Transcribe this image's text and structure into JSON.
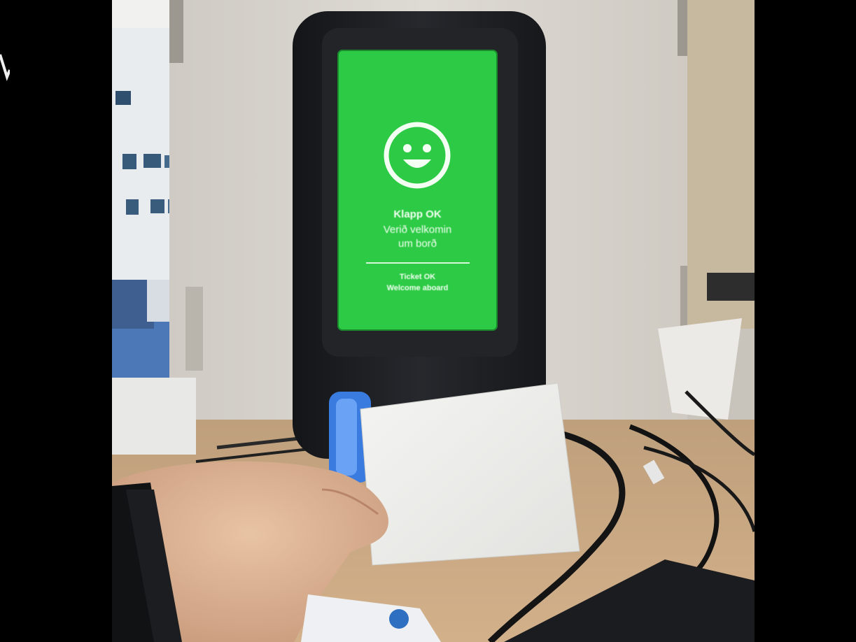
{
  "screen": {
    "line1": "Klapp OK",
    "line2": "Verið velkomin",
    "line3": "um borð",
    "line4": "Ticket OK",
    "line5": "Welcome aboard"
  },
  "colors": {
    "screen_green": "#2dcb45",
    "device_body": "#1e2024",
    "scanner_blue": "#3a7be0",
    "background_board": "#d6d2cb",
    "desk": "#c8a57c"
  },
  "icons": {
    "screen_icon": "smiley-face-icon"
  }
}
